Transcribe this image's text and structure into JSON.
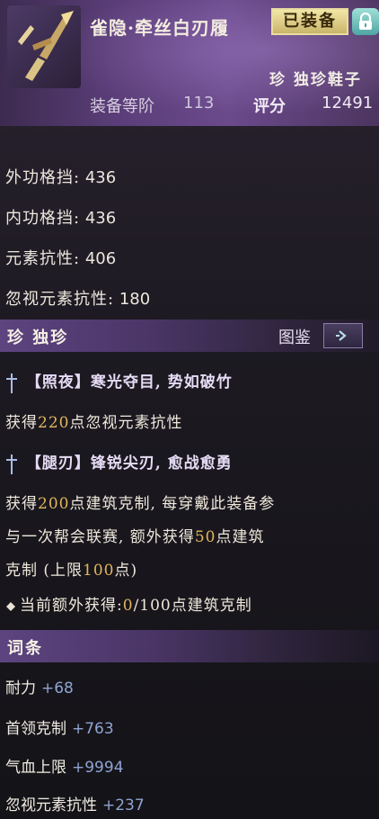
{
  "header": {
    "item_name": "雀隐·牵丝白刃履",
    "equipped_badge": "已装备",
    "rarity_type": "珍 独珍鞋子",
    "level_label": "装备等阶",
    "level_value": "113",
    "score_label": "评分",
    "score_value": "12491"
  },
  "stats": [
    {
      "label": "外功格挡:",
      "value": "436"
    },
    {
      "label": "内功格挡:",
      "value": "436"
    },
    {
      "label": "元素抗性:",
      "value": "406"
    },
    {
      "label": "忽视元素抗性:",
      "value": "180"
    }
  ],
  "unique_section": {
    "title": "珍 独珍",
    "atlas_label": "图鉴"
  },
  "effects": {
    "effect1_title": "【照夜】寒光夺目, 势如破竹",
    "effect1_pre": "获得",
    "effect1_value": "220",
    "effect1_post": "点忽视元素抗性",
    "effect2_title": "【腿刃】锋锐尖刃, 愈战愈勇",
    "effect2_line1_pre": "获得",
    "effect2_line1_value": "200",
    "effect2_line1_post": "点建筑克制, 每穿戴此装备参",
    "effect2_line2_pre": "与一次帮会联赛, 额外获得",
    "effect2_line2_value": "50",
    "effect2_line2_post": "点建筑",
    "effect2_line3_pre": "克制 (上限",
    "effect2_line3_value": "100",
    "effect2_line3_post": "点)",
    "current_pre": "当前额外获得:",
    "current_value": "0",
    "current_post": "/100点建筑克制"
  },
  "affix_section": {
    "title": "词条",
    "rows": [
      {
        "label": "耐力",
        "value": "+68"
      },
      {
        "label": "首领克制",
        "value": "+763"
      },
      {
        "label": "气血上限",
        "value": "+9994"
      },
      {
        "label": "忽视元素抗性",
        "value": "+237"
      }
    ]
  },
  "colors": {
    "highlight_gold": "#e2b65b",
    "affix_blue": "#8fa4d3",
    "header_purple": "#5a3d78"
  },
  "icons": [
    "weapon-item-icon",
    "lock-icon",
    "arrow-right-icon",
    "dagger-icon",
    "diamond-bullet-icon"
  ]
}
